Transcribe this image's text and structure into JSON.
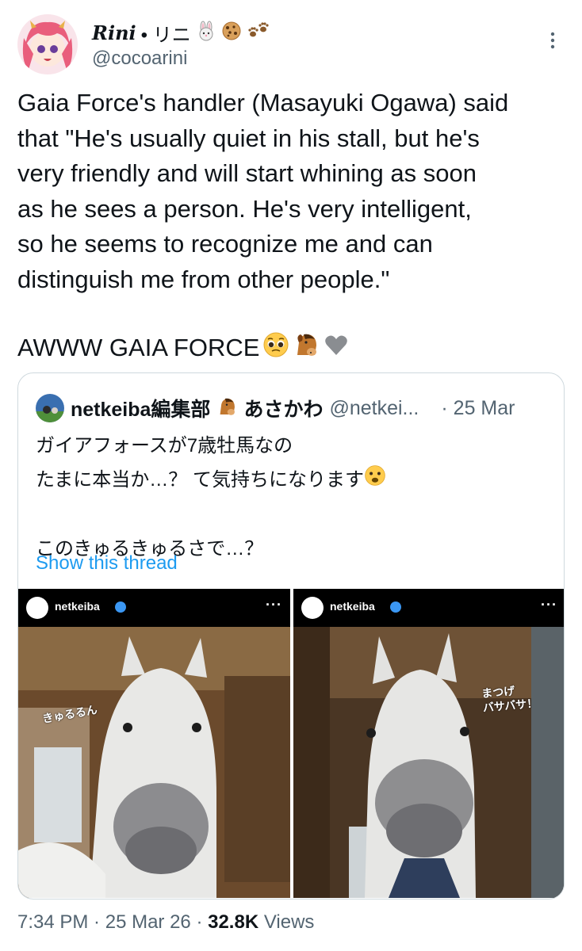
{
  "author": {
    "display_name": "Rini",
    "name_suffix": " • リニ",
    "name_emojis": [
      "bunny-emoji",
      "cookie-emoji",
      "paws-emoji"
    ],
    "handle": "@cocoarini"
  },
  "tweet": {
    "text": "Gaia Force's handler (Masayuki Ogawa) said\nthat \"He's usually quiet in his stall, but he's\nvery friendly and will start whining as soon\nas he sees a person. He's very intelligent,\nso he seems to recognize me and can\ndistinguish me from other people.\"",
    "closing_text": "AWWW GAIA FORCE",
    "closing_emojis": [
      "pleading-face-emoji",
      "horse-face-emoji",
      "grey-heart-emoji"
    ]
  },
  "quote": {
    "name": "netkeiba編集部",
    "name_emoji": "horse-emoji",
    "name2": "あさかわ",
    "handle": "@netkei...",
    "date": "· 25 Mar",
    "text": "ガイアフォースが7歳牡馬なの\nたまに本当か…？ て気持ちになります",
    "text_emoji": "anguished-face-emoji",
    "text2": "このきゅるきゅるさで…？",
    "show_thread": "Show this thread",
    "images": [
      {
        "account": "netkeiba",
        "logo_text": "netkeiba",
        "menu": "···",
        "caption": "きゅるるん"
      },
      {
        "account": "netkeiba",
        "logo_text": "netkeiba",
        "menu": "···",
        "caption": "まつげ\nバサバサ！"
      }
    ]
  },
  "footer": {
    "time": "7:34 PM",
    "sep1": " · ",
    "date": "25 Mar 26",
    "sep2": " · ",
    "views_count": "32.8K",
    "views_label": " Views"
  },
  "colors": {
    "text": "#0f1419",
    "secondary": "#536471",
    "link": "#1d9bf0",
    "border": "#cfd9de"
  }
}
